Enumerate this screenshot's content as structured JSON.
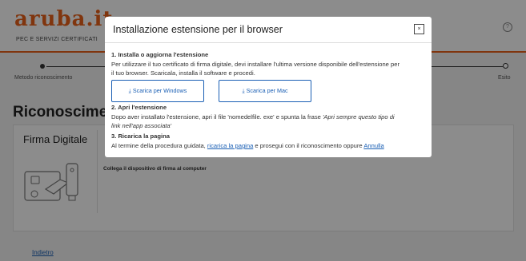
{
  "header": {
    "logo_text": "aruba.it",
    "logo_sub": "PEC E SERVIZI CERTIFICATI",
    "help_icon": "?"
  },
  "stepper": {
    "left_label": "Metodo riconoscimento",
    "right_label": "Esito"
  },
  "main": {
    "title": "Riconoscimen",
    "card_title": "Firma Digitale",
    "card_text": "Collega il dispositivo di firma al computer",
    "back_link": "Indietro"
  },
  "modal": {
    "title": "Installazione estensione per il browser",
    "close_label": "×",
    "step1_title": "1. Installa o aggiorna l'estensione",
    "step1_line1": "Per utilizzare il tuo certificato di firma digitale, devi installare l'ultima versione disponibile dell'estensione per",
    "step1_line2": "il tuo browser. Scaricala, installa il software e procedi.",
    "btn_windows": "Scarica per Windows",
    "btn_mac": "Scarica per Mac",
    "step2_title": "2. Apri l'estensione",
    "step2_line1_a": "Dopo aver installato l'estensione, apri il file 'nomedelfile. exe' e spunta la frase ",
    "step2_line1_b": "'Apri sempre questo tipo di",
    "step2_line2": "link nell'app associata'",
    "step3_title": "3. Ricarica la pagina",
    "step3_a": "Al termine della procedura guidata, ",
    "step3_link1": "ricarica la pagina",
    "step3_b": " e prosegui con il riconoscimento oppure ",
    "step3_link2": "Annulla"
  },
  "colors": {
    "accent": "#e9621b",
    "link": "#1a5fb4"
  }
}
